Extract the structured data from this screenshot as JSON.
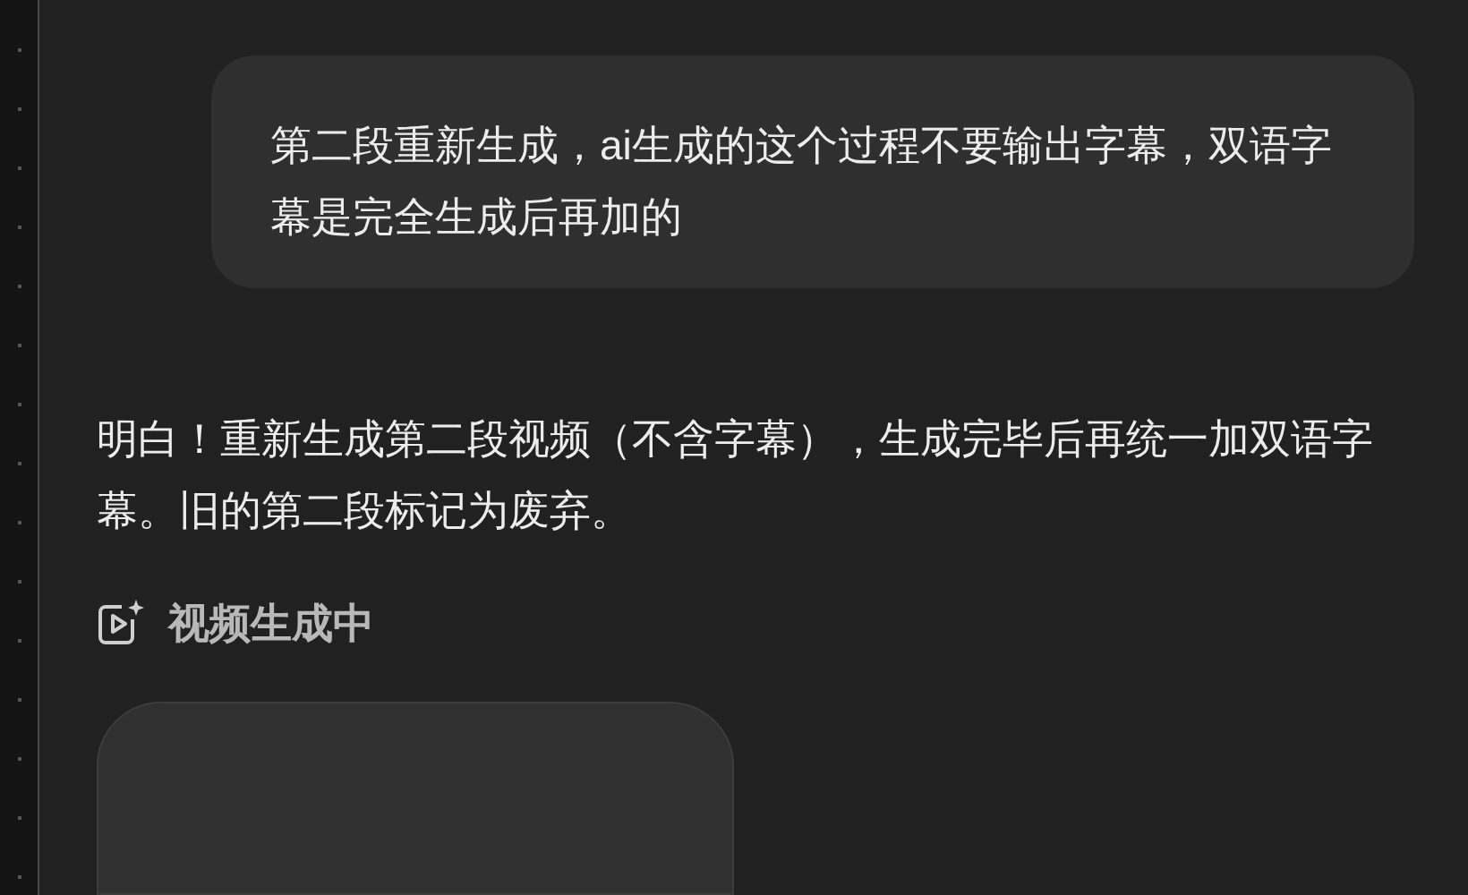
{
  "messages": [
    {
      "kind": "user",
      "text": "第二段重新生成，ai生成的这个过程不要输出字幕，双语字幕是完全生成后再加的"
    },
    {
      "kind": "assistant",
      "text": "明白！重新生成第二段视频（不含字幕），生成完毕后再统一加双语字幕。旧的第二段标记为废弃。"
    }
  ],
  "status": {
    "label": "视频生成中"
  }
}
